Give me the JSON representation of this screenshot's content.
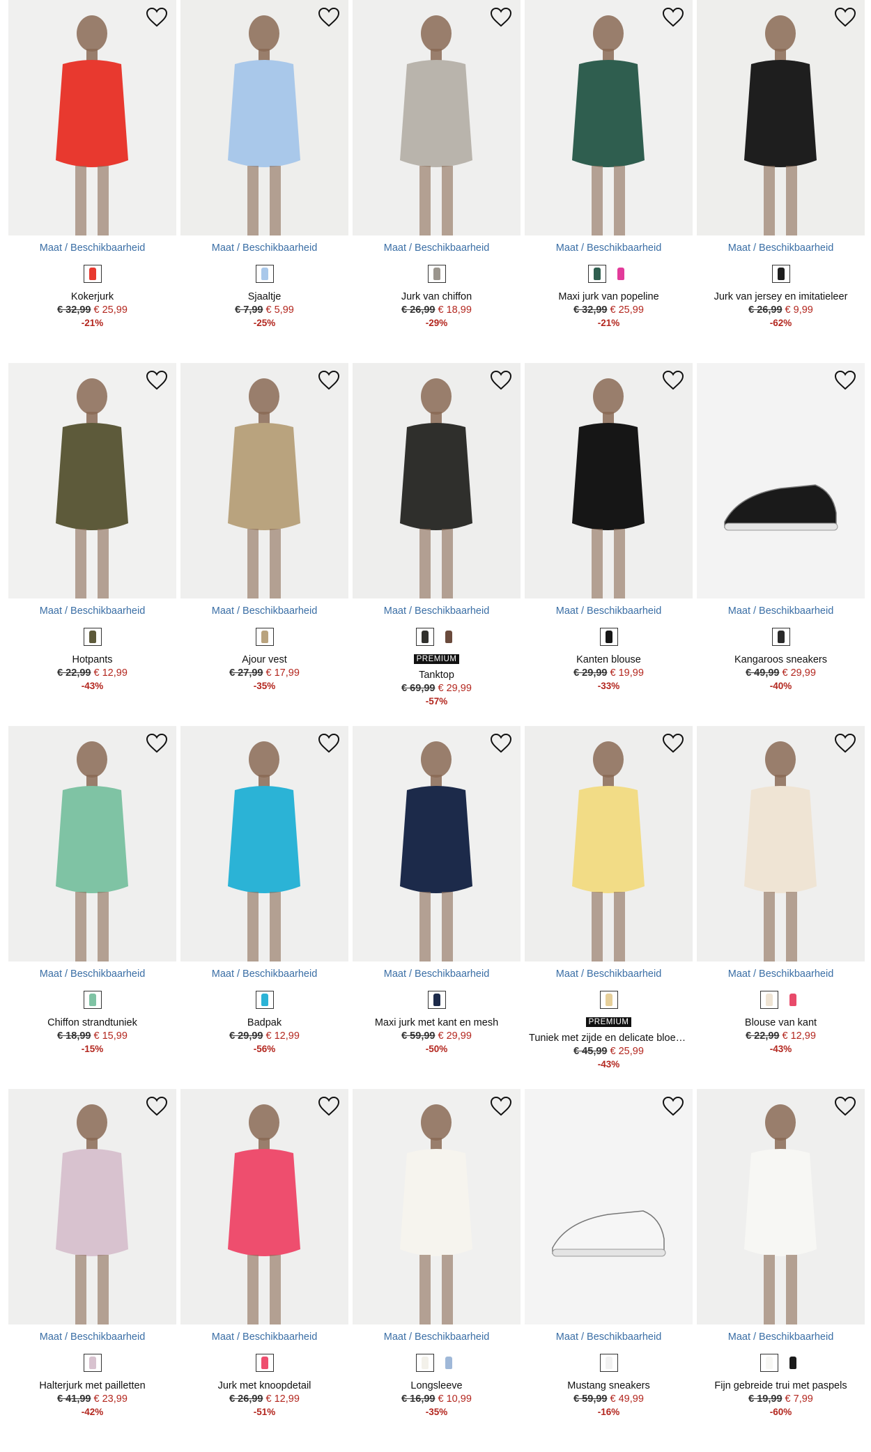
{
  "labels": {
    "size_availability": "Maat / Beschikbaarheid",
    "premium": "PREMIUM"
  },
  "products": [
    {
      "name": "Kokerjurk",
      "old_price": "€ 32,99",
      "new_price": "€ 25,99",
      "discount": "-21%",
      "photo_bg": "#f0f0ef",
      "figure_color": "#e8392f",
      "swatches": [
        "#e8392f"
      ],
      "premium": false
    },
    {
      "name": "Sjaaltje",
      "old_price": "€ 7,99",
      "new_price": "€ 5,99",
      "discount": "-25%",
      "photo_bg": "#eeeeec",
      "figure_color": "#a9c8ea",
      "swatches": [
        "#a9c8ea"
      ],
      "premium": false
    },
    {
      "name": "Jurk van chiffon",
      "old_price": "€ 26,99",
      "new_price": "€ 18,99",
      "discount": "-29%",
      "photo_bg": "#efefee",
      "figure_color": "#b9b4ac",
      "swatches": [
        "#9a958d"
      ],
      "premium": false
    },
    {
      "name": "Maxi jurk van popeline",
      "old_price": "€ 32,99",
      "new_price": "€ 25,99",
      "discount": "-21%",
      "photo_bg": "#f0f0ef",
      "figure_color": "#2f5e4f",
      "swatches": [
        "#2f5e4f",
        "#e23b9a"
      ],
      "premium": false
    },
    {
      "name": "Jurk van jersey en imitatieleer",
      "old_price": "€ 26,99",
      "new_price": "€ 9,99",
      "discount": "-62%",
      "photo_bg": "#eeeeec",
      "figure_color": "#1e1e1e",
      "swatches": [
        "#1e1e1e"
      ],
      "premium": false
    },
    {
      "name": "Hotpants",
      "old_price": "€ 22,99",
      "new_price": "€ 12,99",
      "discount": "-43%",
      "photo_bg": "#f1f1f0",
      "figure_color": "#5d5a3a",
      "swatches": [
        "#5d5a3a"
      ],
      "premium": false
    },
    {
      "name": "Ajour vest",
      "old_price": "€ 27,99",
      "new_price": "€ 17,99",
      "discount": "-35%",
      "photo_bg": "#efefee",
      "figure_color": "#b9a37e",
      "swatches": [
        "#b9a37e"
      ],
      "premium": false
    },
    {
      "name": "Tanktop",
      "old_price": "€ 69,99",
      "new_price": "€ 29,99",
      "discount": "-57%",
      "photo_bg": "#eeeeed",
      "figure_color": "#2f2f2c",
      "swatches": [
        "#2f2f2c",
        "#6a4a3c"
      ],
      "premium": true
    },
    {
      "name": "Kanten blouse",
      "old_price": "€ 29,99",
      "new_price": "€ 19,99",
      "discount": "-33%",
      "photo_bg": "#efefee",
      "figure_color": "#161616",
      "swatches": [
        "#161616"
      ],
      "premium": false
    },
    {
      "name": "Kangaroos sneakers",
      "old_price": "€ 49,99",
      "new_price": "€ 29,99",
      "discount": "-40%",
      "photo_bg": "#f3f3f3",
      "figure_color": "#1a1a1a",
      "swatches": [
        "#2a2a2a"
      ],
      "premium": false
    },
    {
      "name": "Chiffon strandtuniek",
      "old_price": "€ 18,99",
      "new_price": "€ 15,99",
      "discount": "-15%",
      "photo_bg": "#efefee",
      "figure_color": "#7fc3a4",
      "swatches": [
        "#7fc3a4"
      ],
      "premium": false
    },
    {
      "name": "Badpak",
      "old_price": "€ 29,99",
      "new_price": "€ 12,99",
      "discount": "-56%",
      "photo_bg": "#efefee",
      "figure_color": "#2bb3d6",
      "swatches": [
        "#2bb3d6"
      ],
      "premium": false
    },
    {
      "name": "Maxi jurk met kant en mesh",
      "old_price": "€ 59,99",
      "new_price": "€ 29,99",
      "discount": "-50%",
      "photo_bg": "#f0f0ef",
      "figure_color": "#1c2a4a",
      "swatches": [
        "#1c2a4a"
      ],
      "premium": false
    },
    {
      "name": "Tuniek met zijde en delicate bloem...",
      "old_price": "€ 45,99",
      "new_price": "€ 25,99",
      "discount": "-43%",
      "photo_bg": "#eeeeed",
      "figure_color": "#f2dc86",
      "swatches": [
        "#e6cf9a"
      ],
      "premium": true
    },
    {
      "name": "Blouse van kant",
      "old_price": "€ 22,99",
      "new_price": "€ 12,99",
      "discount": "-43%",
      "photo_bg": "#efefee",
      "figure_color": "#efe4d4",
      "swatches": [
        "#efe4d4",
        "#e84a6a"
      ],
      "premium": false
    },
    {
      "name": "Halterjurk met pailletten",
      "old_price": "€ 41,99",
      "new_price": "€ 23,99",
      "discount": "-42%",
      "photo_bg": "#efefee",
      "figure_color": "#d8c2cf",
      "swatches": [
        "#d8c2cf"
      ],
      "premium": false
    },
    {
      "name": "Jurk met knoopdetail",
      "old_price": "€ 26,99",
      "new_price": "€ 12,99",
      "discount": "-51%",
      "photo_bg": "#efefee",
      "figure_color": "#ee4e6e",
      "swatches": [
        "#ee4e6e"
      ],
      "premium": false
    },
    {
      "name": "Longsleeve",
      "old_price": "€ 16,99",
      "new_price": "€ 10,99",
      "discount": "-35%",
      "photo_bg": "#f0f0ef",
      "figure_color": "#f6f4ee",
      "swatches": [
        "#f3f1ea",
        "#9fb8d8"
      ],
      "premium": false
    },
    {
      "name": "Mustang sneakers",
      "old_price": "€ 59,99",
      "new_price": "€ 49,99",
      "discount": "-16%",
      "photo_bg": "#f4f4f4",
      "figure_color": "#f6f6f6",
      "swatches": [
        "#f2f2f2"
      ],
      "premium": false
    },
    {
      "name": "Fijn gebreide trui met paspels",
      "old_price": "€ 19,99",
      "new_price": "€ 7,99",
      "discount": "-60%",
      "photo_bg": "#efefee",
      "figure_color": "#f7f7f4",
      "swatches": [
        "#f7f7f4",
        "#1a1a1a"
      ],
      "premium": false
    }
  ]
}
